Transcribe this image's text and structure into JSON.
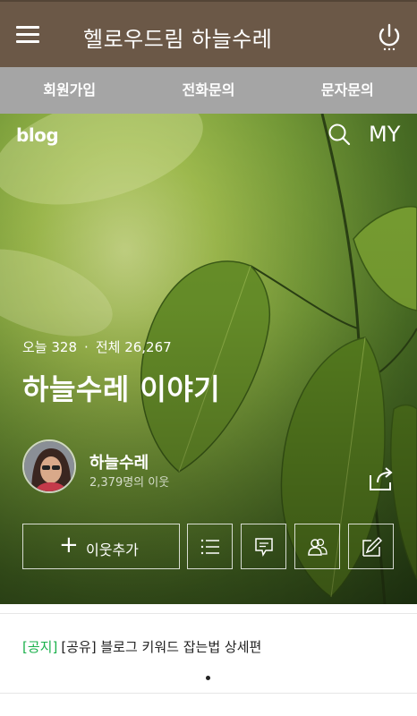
{
  "app": {
    "title": "헬로우드림 하늘수레"
  },
  "tabs": [
    {
      "label": "회원가입"
    },
    {
      "label": "전화문의"
    },
    {
      "label": "문자문의"
    }
  ],
  "hero": {
    "logo": "blog",
    "my_label": "MY",
    "stats": {
      "today_label": "오늘",
      "today_count": "328",
      "total_label": "전체",
      "total_count": "26,267"
    },
    "blog_title": "하늘수레 이야기",
    "author": {
      "name": "하늘수레",
      "neighbors": "2,379명의 이웃"
    },
    "add_neighbor_label": "이웃추가"
  },
  "notice": {
    "tag": "[공지]",
    "text": "[공유] 블로그 키워드 잡는법 상세편"
  },
  "colors": {
    "appbar": "#6b5847",
    "tabs": "#a5a5a5",
    "notice_tag": "#1ab04b"
  },
  "icons": [
    "menu-icon",
    "power-icon",
    "search-icon",
    "share-icon",
    "list-icon",
    "comment-icon",
    "neighbors-icon",
    "write-icon"
  ]
}
